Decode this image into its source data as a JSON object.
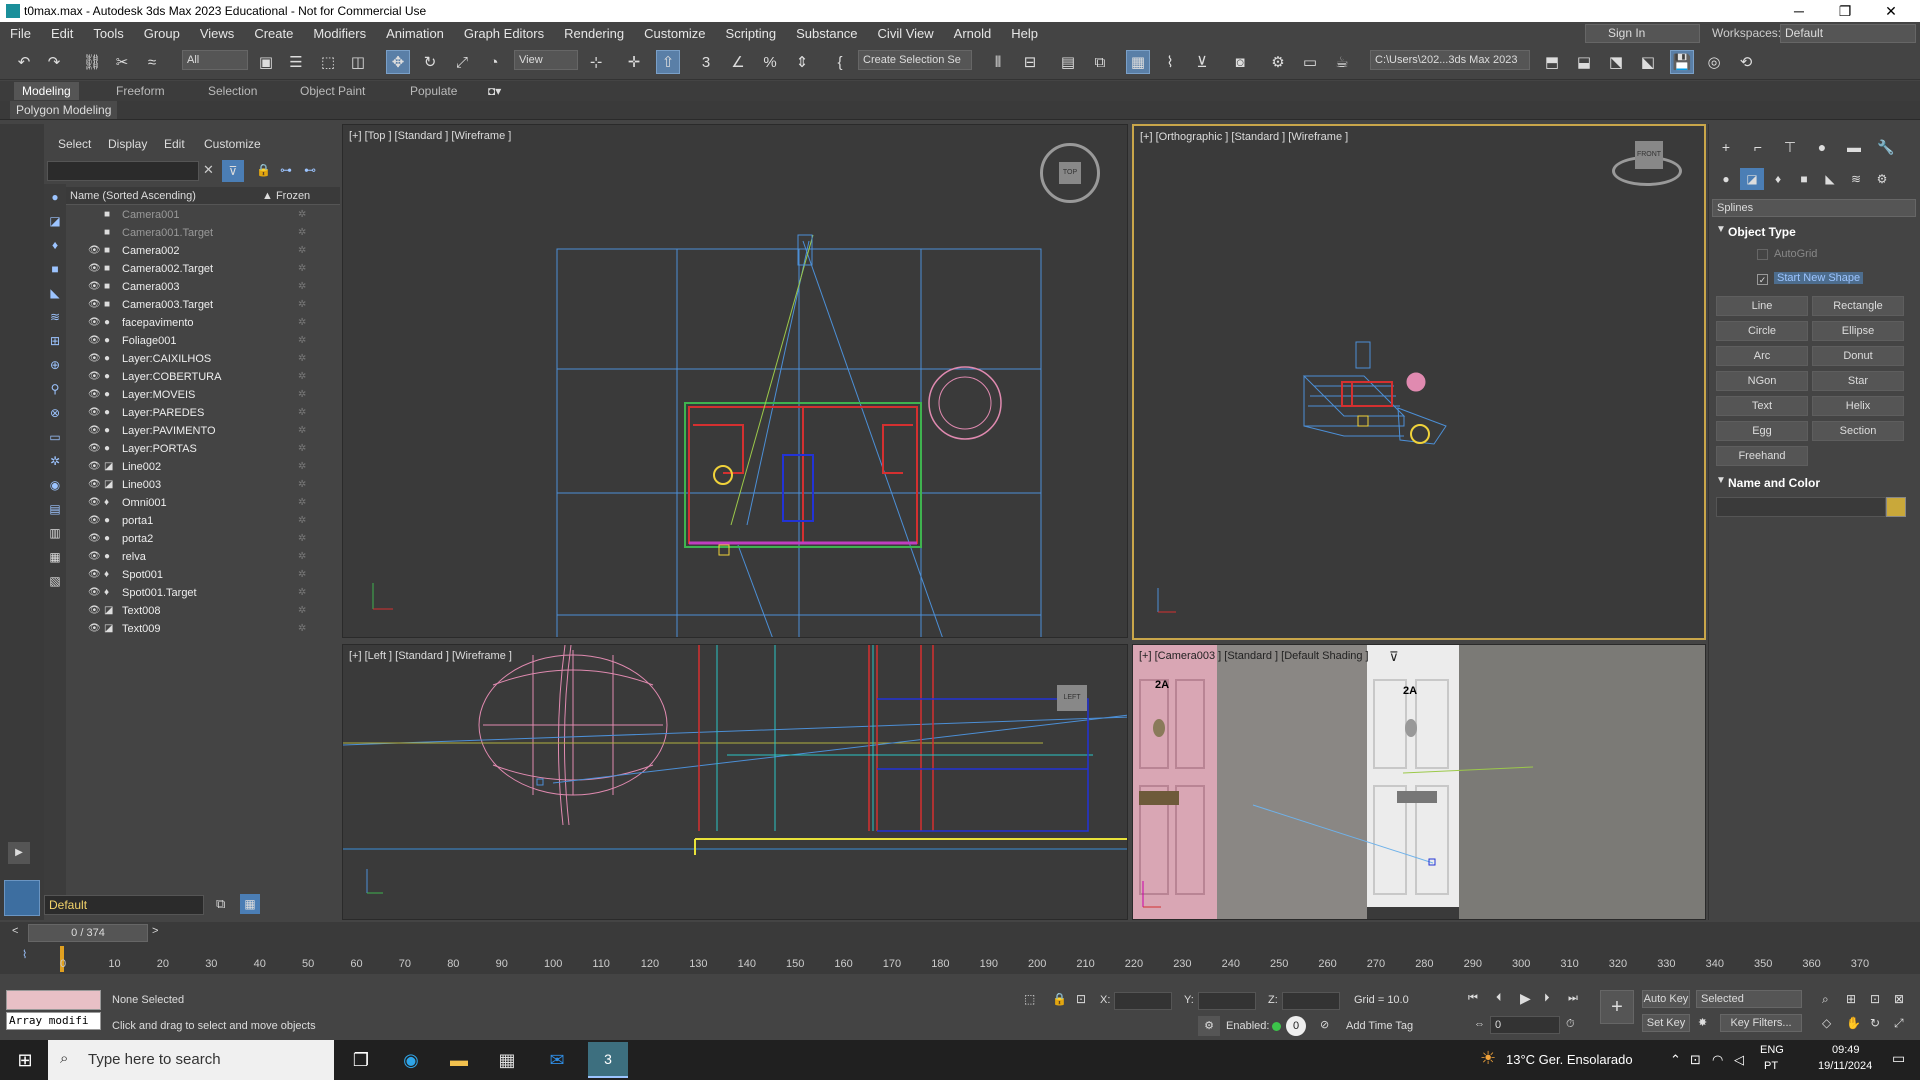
{
  "window": {
    "title": "t0max.max - Autodesk 3ds Max 2023 Educational - Not for Commercial Use",
    "minimize": "─",
    "restore": "❐",
    "close": "✕"
  },
  "menu": [
    "File",
    "Edit",
    "Tools",
    "Group",
    "Views",
    "Create",
    "Modifiers",
    "Animation",
    "Graph Editors",
    "Rendering",
    "Customize",
    "Scripting",
    "Substance",
    "Civil View",
    "Arnold",
    "Help"
  ],
  "header": {
    "sign_in": "Sign In",
    "workspaces_label": "Workspaces:",
    "workspace_value": "Default"
  },
  "toolbar": {
    "filter_value": "All",
    "ref_coord": "View",
    "selection_set_placeholder": "Create Selection Se",
    "path": "C:\\Users\\202...3ds Max 2023"
  },
  "ribbon": {
    "tabs": [
      "Modeling",
      "Freeform",
      "Selection",
      "Object Paint",
      "Populate"
    ],
    "sub": "Polygon Modeling"
  },
  "scene_explorer": {
    "tabs": [
      "Select",
      "Display",
      "Edit",
      "Customize"
    ],
    "col_name": "Name (Sorted Ascending)",
    "col_frozen": "▲ Frozen",
    "items": [
      {
        "name": "Camera001",
        "dim": true,
        "icon": "■"
      },
      {
        "name": "Camera001.Target",
        "dim": true,
        "icon": "■"
      },
      {
        "name": "Camera002",
        "dim": false,
        "icon": "■"
      },
      {
        "name": "Camera002.Target",
        "dim": false,
        "icon": "■"
      },
      {
        "name": "Camera003",
        "dim": false,
        "icon": "■"
      },
      {
        "name": "Camera003.Target",
        "dim": false,
        "icon": "■"
      },
      {
        "name": "facepavimento",
        "dim": false,
        "icon": "●"
      },
      {
        "name": "Foliage001",
        "dim": false,
        "icon": "●"
      },
      {
        "name": "Layer:CAIXILHOS",
        "dim": false,
        "icon": "●"
      },
      {
        "name": "Layer:COBERTURA",
        "dim": false,
        "icon": "●"
      },
      {
        "name": "Layer:MOVEIS",
        "dim": false,
        "icon": "●"
      },
      {
        "name": "Layer:PAREDES",
        "dim": false,
        "icon": "●"
      },
      {
        "name": "Layer:PAVIMENTO",
        "dim": false,
        "icon": "●"
      },
      {
        "name": "Layer:PORTAS",
        "dim": false,
        "icon": "●"
      },
      {
        "name": "Line002",
        "dim": false,
        "icon": "◪"
      },
      {
        "name": "Line003",
        "dim": false,
        "icon": "◪"
      },
      {
        "name": "Omni001",
        "dim": false,
        "icon": "♦"
      },
      {
        "name": "porta1",
        "dim": false,
        "icon": "●"
      },
      {
        "name": "porta2",
        "dim": false,
        "icon": "●"
      },
      {
        "name": "relva",
        "dim": false,
        "icon": "●"
      },
      {
        "name": "Spot001",
        "dim": false,
        "icon": "♦"
      },
      {
        "name": "Spot001.Target",
        "dim": false,
        "icon": "♦"
      },
      {
        "name": "Text008",
        "dim": false,
        "icon": "◪"
      },
      {
        "name": "Text009",
        "dim": false,
        "icon": "◪"
      }
    ],
    "layer": "Default"
  },
  "viewports": {
    "top": "[+] [Top ] [Standard ] [Wireframe ]",
    "ortho": "[+] [Orthographic ] [Standard ] [Wireframe ]",
    "left": "[+] [Left ] [Standard ] [Wireframe ]",
    "camera": "[+] [Camera003 ] [Standard ] [Default Shading ]",
    "door_label_1": "2A",
    "door_label_2": "2A",
    "cube_top": "TOP",
    "cube_front": "FRONT",
    "cube_left": "LEFT"
  },
  "command_panel": {
    "category": "Splines",
    "object_type": "Object Type",
    "autogrid": "AutoGrid",
    "start_new_shape": "Start New Shape",
    "buttons": [
      "Line",
      "Rectangle",
      "Circle",
      "Ellipse",
      "Arc",
      "Donut",
      "NGon",
      "Star",
      "Text",
      "Helix",
      "Egg",
      "Section",
      "Freehand"
    ],
    "name_and_color": "Name and Color",
    "swatch_color": "#c9a83a"
  },
  "timeline": {
    "frame": "0 / 374",
    "ticks": [
      "0",
      "10",
      "20",
      "30",
      "40",
      "50",
      "60",
      "70",
      "80",
      "90",
      "100",
      "110",
      "120",
      "130",
      "140",
      "150",
      "160",
      "170",
      "180",
      "190",
      "200",
      "210",
      "220",
      "230",
      "240",
      "250",
      "260",
      "270",
      "280",
      "290",
      "300",
      "310",
      "320",
      "330",
      "340",
      "350",
      "360",
      "370"
    ]
  },
  "status": {
    "maxscript": "Array modifi",
    "selection": "None Selected",
    "hint": "Click and drag to select and move objects",
    "x_label": "X:",
    "y_label": "Y:",
    "z_label": "Z:",
    "grid": "Grid = 10.0",
    "enabled": "Enabled:",
    "add_time_tag": "Add Time Tag",
    "auto_key": "Auto Key",
    "set_key": "Set Key",
    "selected": "Selected",
    "key_filters": "Key Filters...",
    "frame_field": "0"
  },
  "taskbar": {
    "search": "Type here to search",
    "weather": "13°C  Ger. Ensolarado",
    "lang": "ENG",
    "lang2": "PT",
    "time": "09:49",
    "date": "19/11/2024"
  }
}
